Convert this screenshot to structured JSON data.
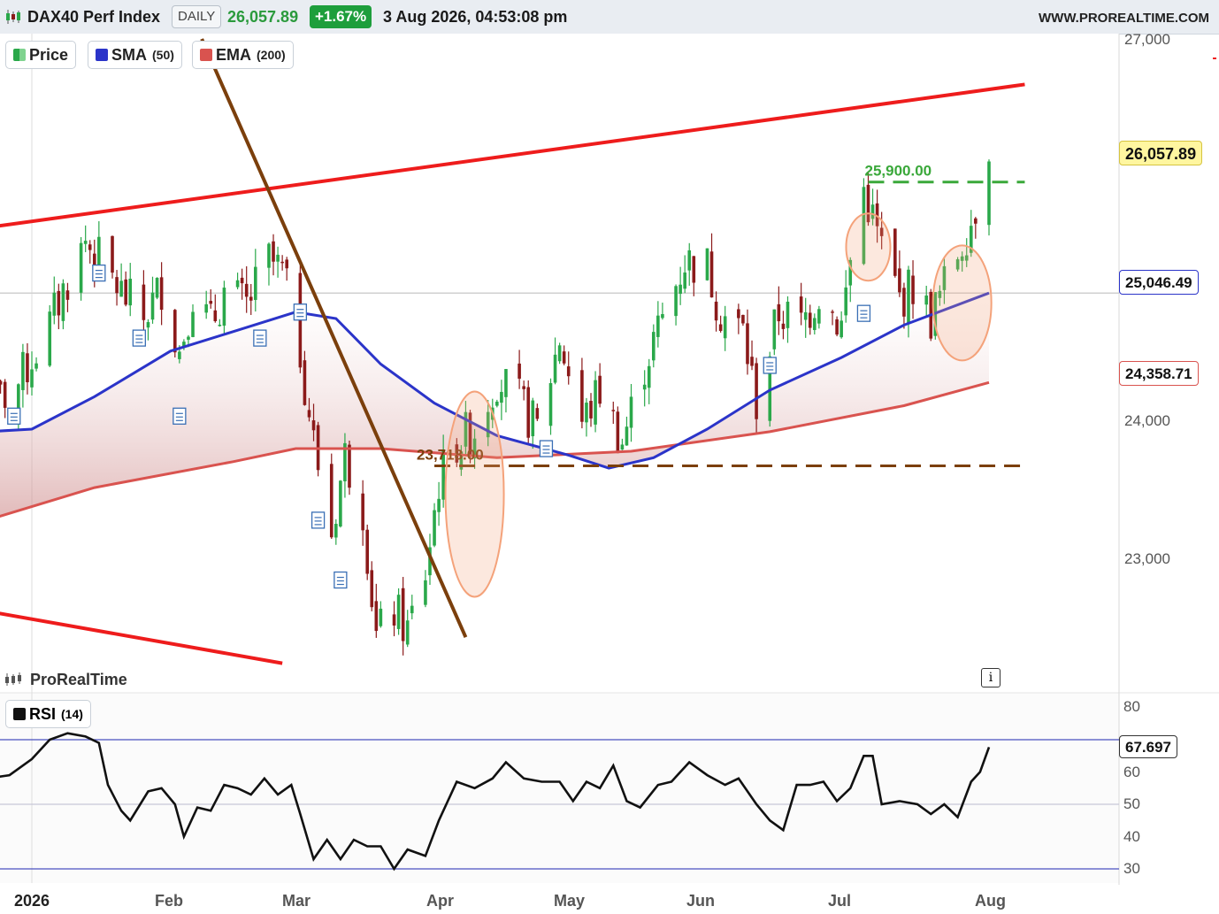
{
  "header": {
    "symbol": "DAX40 Perf Index",
    "timeframe": "DAILY",
    "price": "26,057.89",
    "change": "+1.67%",
    "datetime": "3 Aug 2026, 04:53:08 pm",
    "site": "WWW.PROREALTIME.COM"
  },
  "legend": {
    "price_label": "Price",
    "sma_label": "SMA",
    "sma_param": "(50)",
    "ema_label": "EMA",
    "ema_param": "(200)",
    "rsi_label": "RSI",
    "rsi_param": "(14)"
  },
  "watermark": "ProRealTime",
  "info_icon": "i",
  "price_labels": {
    "last": "26,057.89",
    "sma": "25,046.49",
    "ema": "24,358.71",
    "rsi": "67.697"
  },
  "annotations": {
    "resistance": "25,900.00",
    "support": "23,718.00"
  },
  "colors": {
    "up": "#2aa84a",
    "down": "#8b1a1a",
    "sma": "#2b34c9",
    "ema": "#d9534f",
    "channel": "#ee1c1c",
    "trendline": "#7b3f0c",
    "resistance": "#3aa83a",
    "support": "#7b3f0c",
    "highlight": "#f4a27a"
  },
  "chart_data": [
    {
      "type": "candlestick",
      "title": "DAX40 Perf Index",
      "ylim": [
        22200,
        27050
      ],
      "y_ticks": [
        "27,000",
        "24,000",
        "23,000"
      ],
      "x_ticks": [
        "2026",
        "Feb",
        "Mar",
        "Apr",
        "May",
        "Jun",
        "Jul",
        "Aug"
      ],
      "x_range": [
        "2025-12-22",
        "2026-08-03"
      ],
      "close_path": [
        [
          "2025-12-22",
          24150
        ],
        [
          "2025-12-29",
          24350
        ],
        [
          "2026-01-05",
          24800
        ],
        [
          "2026-01-09",
          25150
        ],
        [
          "2026-01-13",
          25450
        ],
        [
          "2026-01-16",
          25300
        ],
        [
          "2026-01-21",
          25050
        ],
        [
          "2026-01-26",
          24850
        ],
        [
          "2026-01-30",
          25100
        ],
        [
          "2026-02-03",
          24600
        ],
        [
          "2026-02-06",
          25050
        ],
        [
          "2026-02-10",
          24800
        ],
        [
          "2026-02-13",
          25050
        ],
        [
          "2026-02-18",
          24950
        ],
        [
          "2026-02-23",
          25300
        ],
        [
          "2026-02-26",
          25200
        ],
        [
          "2026-03-02",
          24600
        ],
        [
          "2026-03-05",
          23900
        ],
        [
          "2026-03-09",
          23200
        ],
        [
          "2026-03-12",
          23800
        ],
        [
          "2026-03-16",
          23400
        ],
        [
          "2026-03-19",
          22400
        ],
        [
          "2026-03-23",
          22600
        ],
        [
          "2026-03-26",
          22450
        ],
        [
          "2026-03-30",
          22900
        ],
        [
          "2026-04-02",
          23600
        ],
        [
          "2026-04-06",
          23900
        ],
        [
          "2026-04-10",
          24000
        ],
        [
          "2026-04-15",
          24400
        ],
        [
          "2026-04-20",
          24200
        ],
        [
          "2026-04-24",
          24000
        ],
        [
          "2026-04-29",
          24700
        ],
        [
          "2026-05-04",
          24050
        ],
        [
          "2026-05-08",
          24300
        ],
        [
          "2026-05-13",
          23900
        ],
        [
          "2026-05-18",
          24500
        ],
        [
          "2026-05-22",
          24850
        ],
        [
          "2026-05-27",
          25300
        ],
        [
          "2026-06-01",
          25250
        ],
        [
          "2026-06-04",
          24900
        ],
        [
          "2026-06-09",
          24750
        ],
        [
          "2026-06-12",
          24200
        ],
        [
          "2026-06-17",
          24900
        ],
        [
          "2026-06-22",
          24800
        ],
        [
          "2026-06-26",
          25050
        ],
        [
          "2026-07-01",
          24800
        ],
        [
          "2026-07-03",
          25300
        ],
        [
          "2026-07-06",
          25850
        ],
        [
          "2026-07-09",
          25500
        ],
        [
          "2026-07-14",
          25000
        ],
        [
          "2026-07-17",
          25100
        ],
        [
          "2026-07-21",
          24850
        ],
        [
          "2026-07-24",
          25100
        ],
        [
          "2026-07-28",
          25450
        ],
        [
          "2026-07-30",
          25600
        ],
        [
          "2026-08-03",
          26057.89
        ]
      ],
      "series": [
        {
          "name": "SMA (50)",
          "points": [
            [
              "2025-12-22",
              23980
            ],
            [
              "2026-01-01",
              24000
            ],
            [
              "2026-01-15",
              24250
            ],
            [
              "2026-02-01",
              24600
            ],
            [
              "2026-02-15",
              24750
            ],
            [
              "2026-03-01",
              24900
            ],
            [
              "2026-03-10",
              24850
            ],
            [
              "2026-03-20",
              24500
            ],
            [
              "2026-04-01",
              24200
            ],
            [
              "2026-04-15",
              23950
            ],
            [
              "2026-05-01",
              23800
            ],
            [
              "2026-05-10",
              23700
            ],
            [
              "2026-05-20",
              23780
            ],
            [
              "2026-06-01",
              24000
            ],
            [
              "2026-06-15",
              24300
            ],
            [
              "2026-07-01",
              24550
            ],
            [
              "2026-07-15",
              24800
            ],
            [
              "2026-08-03",
              25046.49
            ]
          ]
        },
        {
          "name": "EMA (200)",
          "points": [
            [
              "2025-12-22",
              23300
            ],
            [
              "2026-01-15",
              23550
            ],
            [
              "2026-02-15",
              23750
            ],
            [
              "2026-03-01",
              23850
            ],
            [
              "2026-03-20",
              23850
            ],
            [
              "2026-04-15",
              23780
            ],
            [
              "2026-05-15",
              23830
            ],
            [
              "2026-06-15",
              23980
            ],
            [
              "2026-07-15",
              24180
            ],
            [
              "2026-08-03",
              24358.71
            ]
          ]
        }
      ],
      "lines": [
        {
          "name": "channel-top",
          "points": [
            [
              "2025-12-22",
              25550
            ],
            [
              "2026-08-11",
              26650
            ]
          ]
        },
        {
          "name": "channel-bottom",
          "points": [
            [
              "2025-12-22",
              22600
            ],
            [
              "2026-02-26",
              22200
            ]
          ]
        },
        {
          "name": "downtrend",
          "points": [
            [
              "2026-02-08",
              27000
            ],
            [
              "2026-04-08",
              22400
            ]
          ]
        },
        {
          "name": "resistance",
          "value": 25900,
          "from": "2026-07-07",
          "to": "2026-08-11"
        },
        {
          "name": "support",
          "value": 23718,
          "from": "2026-04-01",
          "to": "2026-08-11"
        }
      ]
    },
    {
      "type": "line",
      "title": "RSI (14)",
      "ylim": [
        28,
        84
      ],
      "y_ticks": [
        80,
        60,
        50,
        40,
        30
      ],
      "ref_lines": [
        70,
        50,
        30
      ],
      "series": [
        {
          "name": "RSI (14)",
          "points": [
            [
              "2025-12-22",
              58
            ],
            [
              "2025-12-27",
              59
            ],
            [
              "2026-01-01",
              64
            ],
            [
              "2026-01-05",
              70
            ],
            [
              "2026-01-09",
              72
            ],
            [
              "2026-01-13",
              71
            ],
            [
              "2026-01-16",
              69
            ],
            [
              "2026-01-18",
              56
            ],
            [
              "2026-01-21",
              48
            ],
            [
              "2026-01-23",
              45
            ],
            [
              "2026-01-27",
              54
            ],
            [
              "2026-01-30",
              55
            ],
            [
              "2026-02-02",
              50
            ],
            [
              "2026-02-04",
              40
            ],
            [
              "2026-02-07",
              49
            ],
            [
              "2026-02-10",
              48
            ],
            [
              "2026-02-13",
              56
            ],
            [
              "2026-02-16",
              55
            ],
            [
              "2026-02-19",
              53
            ],
            [
              "2026-02-22",
              58
            ],
            [
              "2026-02-25",
              53
            ],
            [
              "2026-02-28",
              56
            ],
            [
              "2026-03-02",
              47
            ],
            [
              "2026-03-05",
              33
            ],
            [
              "2026-03-08",
              39
            ],
            [
              "2026-03-11",
              33
            ],
            [
              "2026-03-14",
              39
            ],
            [
              "2026-03-17",
              37
            ],
            [
              "2026-03-20",
              37
            ],
            [
              "2026-03-23",
              30
            ],
            [
              "2026-03-26",
              36
            ],
            [
              "2026-03-30",
              34
            ],
            [
              "2026-04-02",
              45
            ],
            [
              "2026-04-06",
              57
            ],
            [
              "2026-04-10",
              55
            ],
            [
              "2026-04-14",
              58
            ],
            [
              "2026-04-17",
              63
            ],
            [
              "2026-04-21",
              58
            ],
            [
              "2026-04-25",
              57
            ],
            [
              "2026-04-29",
              57
            ],
            [
              "2026-05-02",
              51
            ],
            [
              "2026-05-05",
              57
            ],
            [
              "2026-05-08",
              55
            ],
            [
              "2026-05-11",
              62
            ],
            [
              "2026-05-14",
              51
            ],
            [
              "2026-05-17",
              49
            ],
            [
              "2026-05-21",
              56
            ],
            [
              "2026-05-24",
              57
            ],
            [
              "2026-05-28",
              63
            ],
            [
              "2026-06-01",
              59
            ],
            [
              "2026-06-05",
              56
            ],
            [
              "2026-06-08",
              58
            ],
            [
              "2026-06-12",
              50
            ],
            [
              "2026-06-15",
              45
            ],
            [
              "2026-06-18",
              42
            ],
            [
              "2026-06-21",
              56
            ],
            [
              "2026-06-24",
              56
            ],
            [
              "2026-06-27",
              57
            ],
            [
              "2026-06-30",
              51
            ],
            [
              "2026-07-03",
              55
            ],
            [
              "2026-07-06",
              65
            ],
            [
              "2026-07-08",
              65
            ],
            [
              "2026-07-10",
              50
            ],
            [
              "2026-07-14",
              51
            ],
            [
              "2026-07-18",
              50
            ],
            [
              "2026-07-21",
              47
            ],
            [
              "2026-07-24",
              50
            ],
            [
              "2026-07-27",
              46
            ],
            [
              "2026-07-30",
              57
            ],
            [
              "2026-08-01",
              60
            ],
            [
              "2026-08-03",
              67.697
            ]
          ]
        }
      ]
    }
  ]
}
